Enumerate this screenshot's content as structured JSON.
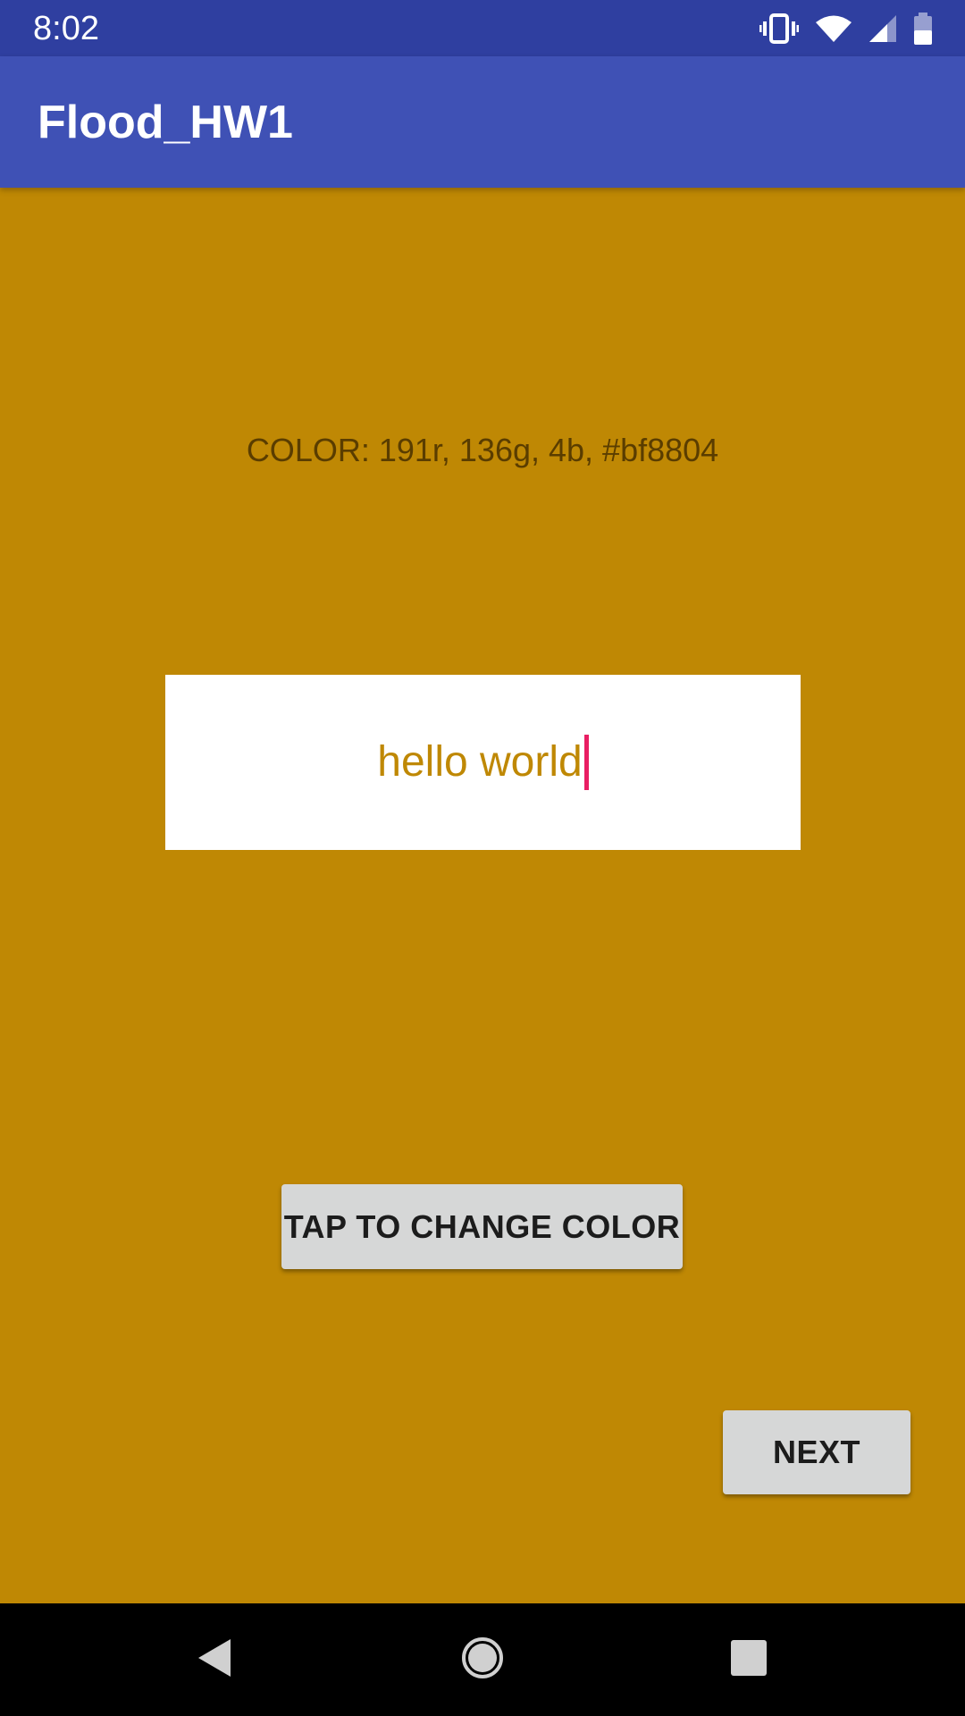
{
  "status_bar": {
    "time": "8:02",
    "icons": [
      "vibrate-icon",
      "wifi-icon",
      "signal-icon",
      "battery-icon"
    ]
  },
  "app_bar": {
    "title": "Flood_HW1"
  },
  "main": {
    "color_label": "COLOR: 191r, 136g, 4b, #bf8804",
    "text_field_value": "hello world",
    "change_color_button": "TAP TO CHANGE COLOR",
    "next_button": "NEXT"
  },
  "nav_bar": {
    "icons": [
      "back-icon",
      "home-icon",
      "recents-icon"
    ]
  },
  "colors": {
    "background": "#bf8804",
    "status_bar": "#2f3fa0",
    "app_bar": "#3f51b5",
    "caret": "#e91e63",
    "button": "#d6d7d7"
  }
}
